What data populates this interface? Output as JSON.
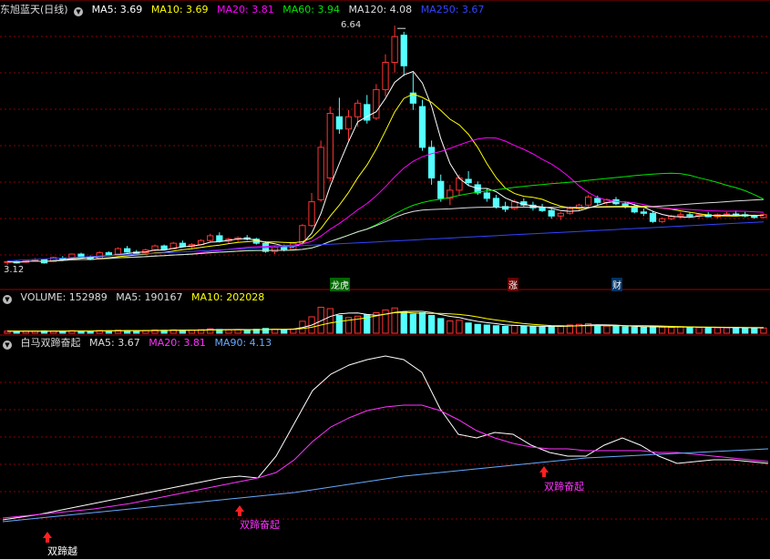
{
  "colors": {
    "up": "#ff3333",
    "down": "#54ffff",
    "ma5": "#ffffff",
    "ma10": "#ffff00",
    "ma20": "#ff00ff",
    "ma60": "#00e600",
    "ma120": "#dddddd",
    "ma250": "#3344ff",
    "grid": "#8b0000",
    "ind_ma90": "#66aaff"
  },
  "chart_data": [
    {
      "type": "candlestick",
      "title": "东旭蓝天(日线)",
      "high_label": "6.64",
      "low_label": "3.12",
      "events": [
        "龙虎",
        "涨",
        "财"
      ],
      "ylim": [
        3.0,
        6.75
      ],
      "candles": [
        [
          3.16,
          3.18,
          3.12,
          3.17
        ],
        [
          3.17,
          3.18,
          3.14,
          3.15
        ],
        [
          3.16,
          3.2,
          3.15,
          3.19
        ],
        [
          3.19,
          3.22,
          3.17,
          3.2
        ],
        [
          3.2,
          3.21,
          3.14,
          3.15
        ],
        [
          3.17,
          3.24,
          3.16,
          3.23
        ],
        [
          3.22,
          3.25,
          3.19,
          3.21
        ],
        [
          3.22,
          3.29,
          3.21,
          3.28
        ],
        [
          3.28,
          3.3,
          3.22,
          3.23
        ],
        [
          3.23,
          3.26,
          3.19,
          3.2
        ],
        [
          3.22,
          3.32,
          3.21,
          3.3
        ],
        [
          3.3,
          3.32,
          3.25,
          3.27
        ],
        [
          3.28,
          3.38,
          3.27,
          3.36
        ],
        [
          3.36,
          3.4,
          3.3,
          3.31
        ],
        [
          3.31,
          3.34,
          3.27,
          3.29
        ],
        [
          3.3,
          3.36,
          3.28,
          3.34
        ],
        [
          3.34,
          3.42,
          3.32,
          3.4
        ],
        [
          3.4,
          3.42,
          3.34,
          3.35
        ],
        [
          3.36,
          3.46,
          3.35,
          3.44
        ],
        [
          3.44,
          3.48,
          3.38,
          3.39
        ],
        [
          3.39,
          3.44,
          3.36,
          3.42
        ],
        [
          3.42,
          3.5,
          3.41,
          3.48
        ],
        [
          3.48,
          3.58,
          3.46,
          3.55
        ],
        [
          3.55,
          3.6,
          3.45,
          3.47
        ],
        [
          3.47,
          3.52,
          3.43,
          3.5
        ],
        [
          3.5,
          3.54,
          3.46,
          3.52
        ],
        [
          3.52,
          3.56,
          3.48,
          3.5
        ],
        [
          3.5,
          3.52,
          3.42,
          3.44
        ],
        [
          3.44,
          3.47,
          3.3,
          3.32
        ],
        [
          3.32,
          3.4,
          3.28,
          3.38
        ],
        [
          3.38,
          3.42,
          3.32,
          3.35
        ],
        [
          3.35,
          3.46,
          3.34,
          3.44
        ],
        [
          3.44,
          3.72,
          3.42,
          3.7
        ],
        [
          3.7,
          4.18,
          3.68,
          4.05
        ],
        [
          4.08,
          4.95,
          4.05,
          4.85
        ],
        [
          4.4,
          5.45,
          4.35,
          5.35
        ],
        [
          5.3,
          5.58,
          5.05,
          5.12
        ],
        [
          5.12,
          5.4,
          4.95,
          5.3
        ],
        [
          5.3,
          5.55,
          5.15,
          5.5
        ],
        [
          5.48,
          5.62,
          5.2,
          5.25
        ],
        [
          5.28,
          5.78,
          5.25,
          5.7
        ],
        [
          5.7,
          6.22,
          5.6,
          6.1
        ],
        [
          6.1,
          6.64,
          5.95,
          6.48
        ],
        [
          6.5,
          6.55,
          5.9,
          6.05
        ],
        [
          5.65,
          5.95,
          5.4,
          5.5
        ],
        [
          5.45,
          5.55,
          4.8,
          4.85
        ],
        [
          4.85,
          4.95,
          4.3,
          4.4
        ],
        [
          4.35,
          4.45,
          4.05,
          4.1
        ],
        [
          4.1,
          4.3,
          4.0,
          4.22
        ],
        [
          4.22,
          4.45,
          4.15,
          4.4
        ],
        [
          4.38,
          4.5,
          4.28,
          4.33
        ],
        [
          4.3,
          4.35,
          4.15,
          4.18
        ],
        [
          4.18,
          4.25,
          4.05,
          4.1
        ],
        [
          4.1,
          4.15,
          3.95,
          3.98
        ],
        [
          3.98,
          4.05,
          3.9,
          3.94
        ],
        [
          3.95,
          4.08,
          3.93,
          4.05
        ],
        [
          4.05,
          4.1,
          3.98,
          4.0
        ],
        [
          4.0,
          4.05,
          3.92,
          3.96
        ],
        [
          3.96,
          4.02,
          3.9,
          3.92
        ],
        [
          3.92,
          3.96,
          3.8,
          3.84
        ],
        [
          3.84,
          3.9,
          3.78,
          3.88
        ],
        [
          3.88,
          3.98,
          3.86,
          3.95
        ],
        [
          3.95,
          4.02,
          3.92,
          4.0
        ],
        [
          4.0,
          4.15,
          3.98,
          4.12
        ],
        [
          4.1,
          4.14,
          4.0,
          4.04
        ],
        [
          4.04,
          4.1,
          4.0,
          4.08
        ],
        [
          4.08,
          4.12,
          4.0,
          4.02
        ],
        [
          4.02,
          4.06,
          3.95,
          3.98
        ],
        [
          3.98,
          4.02,
          3.88,
          3.9
        ],
        [
          3.9,
          3.95,
          3.84,
          3.88
        ],
        [
          3.88,
          3.92,
          3.74,
          3.76
        ],
        [
          3.76,
          3.82,
          3.74,
          3.8
        ],
        [
          3.8,
          3.86,
          3.78,
          3.84
        ],
        [
          3.84,
          3.9,
          3.8,
          3.86
        ],
        [
          3.86,
          3.9,
          3.82,
          3.84
        ],
        [
          3.84,
          3.88,
          3.8,
          3.86
        ],
        [
          3.86,
          3.9,
          3.82,
          3.83
        ],
        [
          3.83,
          3.88,
          3.8,
          3.86
        ],
        [
          3.86,
          3.9,
          3.84,
          3.87
        ],
        [
          3.87,
          3.92,
          3.84,
          3.86
        ],
        [
          3.86,
          3.9,
          3.82,
          3.84
        ],
        [
          3.84,
          3.86,
          3.8,
          3.82
        ],
        [
          3.82,
          3.88,
          3.8,
          3.86
        ]
      ],
      "series": [
        {
          "name": "MA5",
          "label": "MA5: 3.69"
        },
        {
          "name": "MA10",
          "label": "MA10: 3.69"
        },
        {
          "name": "MA20",
          "label": "MA20: 3.81"
        },
        {
          "name": "MA60",
          "label": "MA60: 3.94"
        },
        {
          "name": "MA120",
          "label": "MA120: 4.08"
        },
        {
          "name": "MA250",
          "label": "MA250: 3.67"
        }
      ]
    },
    {
      "type": "bar",
      "label_volume": "VOLUME: 152989",
      "label_ma5": "MA5: 190167",
      "label_ma10": "MA10: 202028",
      "ylim": [
        0,
        800000
      ],
      "values": [
        60000,
        55000,
        62000,
        58000,
        70000,
        65000,
        60000,
        75000,
        68000,
        62000,
        80000,
        72000,
        90000,
        78000,
        70000,
        82000,
        95000,
        85000,
        100000,
        88000,
        92000,
        105000,
        130000,
        110000,
        98000,
        102000,
        95000,
        115000,
        140000,
        120000,
        105000,
        125000,
        350000,
        480000,
        760000,
        720000,
        520000,
        460000,
        500000,
        540000,
        600000,
        680000,
        740000,
        620000,
        560000,
        600000,
        520000,
        430000,
        360000,
        380000,
        300000,
        260000,
        240000,
        220000,
        200000,
        230000,
        210000,
        190000,
        180000,
        200000,
        220000,
        240000,
        260000,
        280000,
        230000,
        210000,
        200000,
        190000,
        180000,
        170000,
        200000,
        180000,
        170000,
        190000,
        175000,
        165000,
        170000,
        160000,
        158000,
        165000,
        160000,
        155000,
        152989
      ]
    },
    {
      "type": "line",
      "title": "白马双蹄奋起",
      "ylim": [
        0,
        1
      ],
      "series": [
        {
          "name": "MA5",
          "label": "MA5: 3.67",
          "values": [
            0.07,
            0.085,
            0.1,
            0.12,
            0.14,
            0.16,
            0.18,
            0.2,
            0.22,
            0.24,
            0.26,
            0.28,
            0.3,
            0.31,
            0.3,
            0.42,
            0.6,
            0.78,
            0.87,
            0.92,
            0.95,
            0.97,
            0.95,
            0.88,
            0.68,
            0.54,
            0.52,
            0.55,
            0.54,
            0.48,
            0.44,
            0.42,
            0.42,
            0.48,
            0.52,
            0.48,
            0.42,
            0.38,
            0.39,
            0.4,
            0.4,
            0.39,
            0.38
          ]
        },
        {
          "name": "MA20",
          "label": "MA20: 3.81",
          "values": [
            0.08,
            0.09,
            0.1,
            0.11,
            0.12,
            0.13,
            0.145,
            0.16,
            0.18,
            0.2,
            0.22,
            0.24,
            0.26,
            0.28,
            0.3,
            0.33,
            0.4,
            0.5,
            0.58,
            0.63,
            0.67,
            0.69,
            0.7,
            0.7,
            0.67,
            0.62,
            0.56,
            0.52,
            0.49,
            0.47,
            0.46,
            0.46,
            0.45,
            0.45,
            0.45,
            0.45,
            0.44,
            0.44,
            0.43,
            0.42,
            0.41,
            0.4,
            0.39
          ]
        },
        {
          "name": "MA90",
          "label": "MA90: 4.13",
          "values": [
            0.06,
            0.07,
            0.08,
            0.09,
            0.1,
            0.11,
            0.12,
            0.13,
            0.14,
            0.15,
            0.16,
            0.17,
            0.18,
            0.19,
            0.2,
            0.21,
            0.22,
            0.235,
            0.25,
            0.265,
            0.28,
            0.295,
            0.31,
            0.32,
            0.33,
            0.34,
            0.35,
            0.36,
            0.37,
            0.38,
            0.39,
            0.4,
            0.41,
            0.415,
            0.42,
            0.425,
            0.43,
            0.435,
            0.44,
            0.445,
            0.45,
            0.455,
            0.46
          ]
        }
      ],
      "signals": [
        {
          "text": "双蹄越"
        },
        {
          "text": "双蹄奋起"
        },
        {
          "text": "双蹄奋起"
        }
      ]
    }
  ]
}
